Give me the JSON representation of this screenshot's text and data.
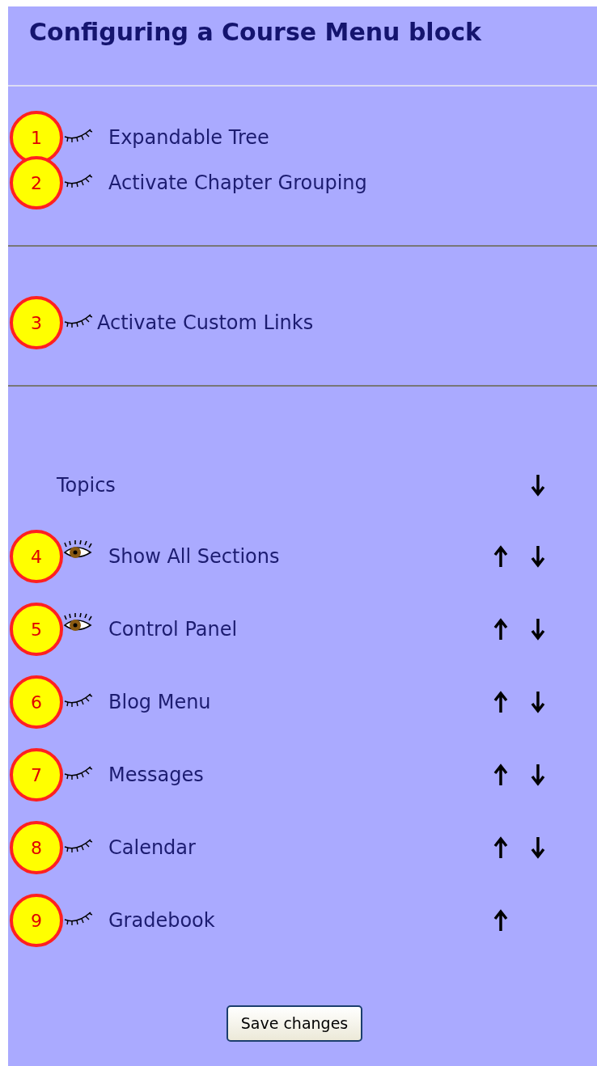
{
  "title": "Configuring a Course Menu block",
  "settings": [
    {
      "callout": "1",
      "label": "Expandable Tree",
      "visible": false
    },
    {
      "callout": "2",
      "label": "Activate Chapter Grouping",
      "visible": false
    }
  ],
  "custom_links": [
    {
      "callout": "3",
      "label": "Activate Custom Links",
      "visible": false
    }
  ],
  "topics": {
    "label": "Topics",
    "up": false,
    "down": true
  },
  "items": [
    {
      "callout": "4",
      "label": "Show All Sections",
      "visible": true,
      "up": true,
      "down": true
    },
    {
      "callout": "5",
      "label": "Control Panel",
      "visible": true,
      "up": true,
      "down": true
    },
    {
      "callout": "6",
      "label": "Blog Menu",
      "visible": false,
      "up": true,
      "down": true
    },
    {
      "callout": "7",
      "label": "Messages",
      "visible": false,
      "up": true,
      "down": true
    },
    {
      "callout": "8",
      "label": "Calendar",
      "visible": false,
      "up": true,
      "down": true
    },
    {
      "callout": "9",
      "label": "Gradebook",
      "visible": false,
      "up": true,
      "down": false
    }
  ],
  "save_button": "Save changes"
}
